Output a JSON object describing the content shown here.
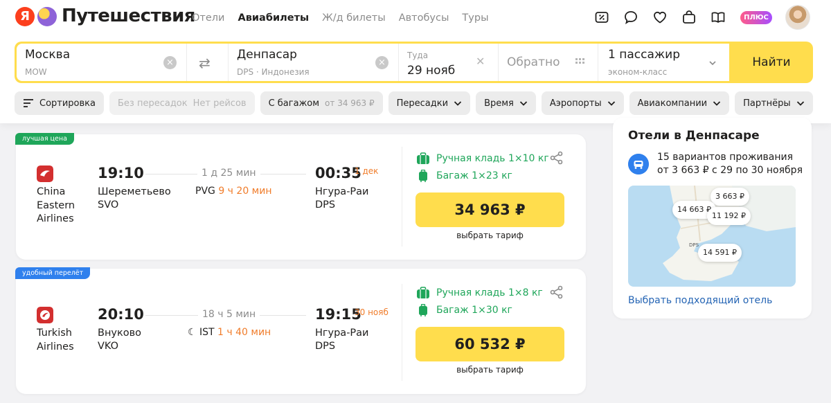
{
  "header": {
    "brand": "Путешествия",
    "logo_letter": "Я",
    "nav": [
      "Отели",
      "Авиабилеты",
      "Ж/д билеты",
      "Автобусы",
      "Туры"
    ],
    "nav_active": "Авиабилеты",
    "plus_label": "ПЛЮС",
    "icons": [
      "percent-tag-icon",
      "chat-bubble-icon",
      "heart-icon",
      "bag-icon",
      "book-icon"
    ]
  },
  "search": {
    "from_city": "Москва",
    "from_code": "MOW",
    "to_city": "Денпасар",
    "to_sub": "DPS · Индонезия",
    "depart_label": "Туда",
    "depart_value": "29 нояб",
    "return_placeholder": "Обратно",
    "passengers": "1 пассажир",
    "cabin_class": "эконом-класс",
    "find_label": "Найти"
  },
  "filters": {
    "sort": "Сортировка",
    "nonstop": "Без пересадок",
    "nonstop_note": "Нет рейсов",
    "with_baggage": "С багажом",
    "baggage_price": "от 34 963 ₽",
    "transfers": "Пересадки",
    "time": "Время",
    "airports": "Аэропорты",
    "airlines": "Авиакомпании",
    "partners": "Партнёры"
  },
  "flights": [
    {
      "tag": "лучшая цена",
      "airline": "China Eastern Airlines",
      "depart_time": "19:10",
      "depart_airport": "Шереметьево",
      "depart_code": "SVO",
      "duration": "1 д 25 мин",
      "transfer_code": "PVG",
      "transfer_wait": "9 ч 20 мин",
      "arrive_time": "00:35",
      "arrive_date": "1 дек",
      "arrive_airport": "Нгура-Раи",
      "arrive_code": "DPS",
      "hand_luggage": "Ручная кладь 1×10 кг",
      "baggage": "Багаж 1×23 кг",
      "price": "34 963 ₽",
      "tariff": "выбрать тариф"
    },
    {
      "tag": "удобный перелёт",
      "airline": "Turkish Airlines",
      "depart_time": "20:10",
      "depart_airport": "Внуково",
      "depart_code": "VKO",
      "duration": "18 ч 5 мин",
      "transfer_code": "IST",
      "transfer_wait": "1 ч 40 мин",
      "arrive_time": "19:15",
      "arrive_date": "30 нояб",
      "arrive_airport": "Нгура-Раи",
      "arrive_code": "DPS",
      "hand_luggage": "Ручная кладь 1×8 кг",
      "baggage": "Багаж 1×30 кг",
      "price": "60 532 ₽",
      "tariff": "выбрать тариф"
    }
  ],
  "hotels": {
    "title": "Отели в Денпасаре",
    "text": "15 вариантов проживания от 3 663 ₽ с 29 по 30 ноября",
    "map_pins": [
      "3 663 ₽",
      "14 663 ₽",
      "11 192 ₽",
      "14 591 ₽"
    ],
    "map_airport": "DPS",
    "link": "Выбрать подходящий отель"
  },
  "colors": {
    "accent_yellow": "#ffdd4d",
    "green": "#1fa65a",
    "blue": "#2f80ed",
    "orange": "#f07c2a",
    "link": "#2464b4"
  }
}
